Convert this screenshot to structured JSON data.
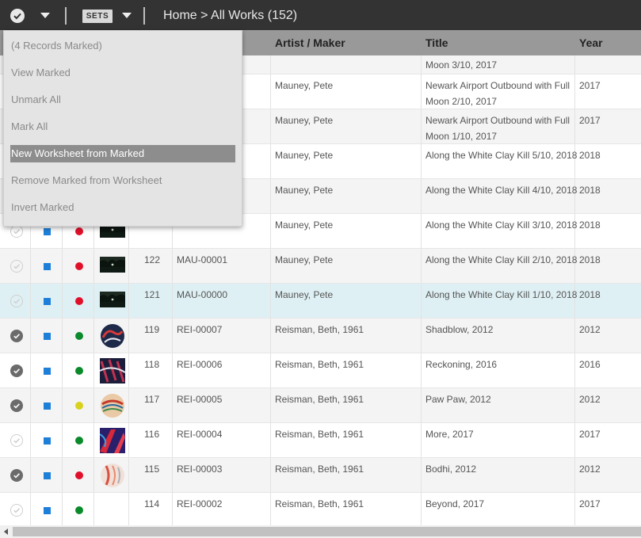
{
  "toolbar": {
    "sets_label": "SETS",
    "breadcrumb": "Home > All Works (152)"
  },
  "columns": {
    "artist": "Artist / Maker",
    "title": "Title",
    "year": "Year"
  },
  "menu": {
    "items": [
      {
        "label": "(4 Records Marked)",
        "active": false
      },
      {
        "label": "View Marked",
        "active": false
      },
      {
        "label": "Unmark All",
        "active": false
      },
      {
        "label": "Mark All",
        "active": false
      },
      {
        "label": "New Worksheet from Marked",
        "active": true
      },
      {
        "label": "Remove Marked from Worksheet",
        "active": false
      },
      {
        "label": "Invert Marked",
        "active": false
      }
    ]
  },
  "colors": {
    "status_red": "#e0102a",
    "status_green": "#0a8a2a",
    "status_yellow": "#d8d21e",
    "selected_row": "#dff0f4",
    "topbar": "#333333"
  },
  "rows": [
    {
      "marked": null,
      "status": null,
      "thumb": null,
      "num": "",
      "id": "",
      "artist": "",
      "title_lines": [
        "Moon 3/10, 2017"
      ],
      "year": ""
    },
    {
      "marked": null,
      "status": null,
      "thumb": null,
      "num": "",
      "id": "",
      "artist": "Mauney, Pete",
      "title_lines": [
        "Newark Airport Outbound with Full",
        "Moon 2/10, 2017"
      ],
      "year": "2017"
    },
    {
      "marked": null,
      "status": null,
      "thumb": null,
      "num": "",
      "id": "",
      "artist": "Mauney, Pete",
      "title_lines": [
        "Newark Airport Outbound with Full",
        "Moon 1/10, 2017"
      ],
      "year": "2017"
    },
    {
      "marked": null,
      "status": null,
      "thumb": null,
      "num": "",
      "id": "",
      "artist": "Mauney, Pete",
      "title_lines": [
        "Along the White Clay Kill 5/10, 2018"
      ],
      "year": "2018"
    },
    {
      "marked": null,
      "status": null,
      "thumb": null,
      "num": "",
      "id": "",
      "artist": "Mauney, Pete",
      "title_lines": [
        "Along the White Clay Kill 4/10, 2018"
      ],
      "year": "2018"
    },
    {
      "marked": false,
      "status": "red",
      "thumb": "night",
      "num": "",
      "id": "",
      "artist": "Mauney, Pete",
      "title_lines": [
        "Along the White Clay Kill 3/10, 2018"
      ],
      "year": "2018"
    },
    {
      "marked": false,
      "status": "red",
      "thumb": "night",
      "num": "122",
      "id": "MAU-00001",
      "artist": "Mauney, Pete",
      "title_lines": [
        "Along the White Clay Kill 2/10, 2018"
      ],
      "year": "2018"
    },
    {
      "marked": false,
      "status": "red",
      "thumb": "night",
      "num": "121",
      "id": "MAU-00000",
      "artist": "Mauney, Pete",
      "title_lines": [
        "Along the White Clay Kill 1/10, 2018"
      ],
      "year": "2018",
      "selected": true
    },
    {
      "marked": true,
      "status": "green",
      "thumb": "circle-dark",
      "num": "119",
      "id": "REI-00007",
      "artist": "Reisman, Beth, 1961",
      "title_lines": [
        "Shadblow, 2012"
      ],
      "year": "2012"
    },
    {
      "marked": true,
      "status": "green",
      "thumb": "abstract-dark",
      "num": "118",
      "id": "REI-00006",
      "artist": "Reisman, Beth, 1961",
      "title_lines": [
        "Reckoning, 2016"
      ],
      "year": "2016"
    },
    {
      "marked": true,
      "status": "yellow",
      "thumb": "circle-warm",
      "num": "117",
      "id": "REI-00005",
      "artist": "Reisman, Beth, 1961",
      "title_lines": [
        "Paw Paw, 2012"
      ],
      "year": "2012"
    },
    {
      "marked": false,
      "status": "green",
      "thumb": "abstract-red",
      "num": "116",
      "id": "REI-00004",
      "artist": "Reisman, Beth, 1961",
      "title_lines": [
        "More, 2017"
      ],
      "year": "2017"
    },
    {
      "marked": true,
      "status": "red",
      "thumb": "circle-light",
      "num": "115",
      "id": "REI-00003",
      "artist": "Reisman, Beth, 1961",
      "title_lines": [
        "Bodhi, 2012"
      ],
      "year": "2012"
    },
    {
      "marked": false,
      "status": "green",
      "thumb": null,
      "num": "114",
      "id": "REI-00002",
      "artist": "Reisman, Beth, 1961",
      "title_lines": [
        "Beyond, 2017"
      ],
      "year": "2017"
    }
  ]
}
